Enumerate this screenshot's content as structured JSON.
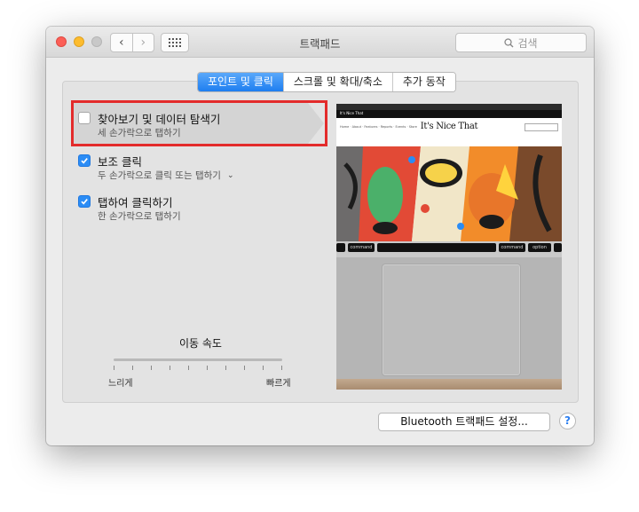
{
  "window": {
    "title": "트랙패드",
    "search_placeholder": "검색",
    "nav_back": "‹",
    "nav_forward": "›"
  },
  "tabs": [
    {
      "label": "포인트 및 클릭",
      "active": true
    },
    {
      "label": "스크롤 및 확대/축소",
      "active": false
    },
    {
      "label": "추가 동작",
      "active": false
    }
  ],
  "options": [
    {
      "title": "찾아보기 및 데이터 탐색기",
      "subtitle": "세 손가락으로 탭하기",
      "checked": false,
      "has_dropdown": false
    },
    {
      "title": "보조 클릭",
      "subtitle": "두 손가락으로 클릭 또는 탭하기",
      "checked": true,
      "has_dropdown": true
    },
    {
      "title": "탭하여 클릭하기",
      "subtitle": "한 손가락으로 탭하기",
      "checked": true,
      "has_dropdown": false
    }
  ],
  "tracking_speed": {
    "label": "이동 속도",
    "min_label": "느리게",
    "max_label": "빠르게",
    "value_fraction": 0.35
  },
  "preview": {
    "site_title": "It's Nice That",
    "site_brand": "It's Nice That",
    "keys": [
      "command",
      "command",
      "option"
    ]
  },
  "footer": {
    "bluetooth_button": "Bluetooth 트랙패드 설정...",
    "help_button": "?"
  },
  "colors": {
    "accent": "#2b8cf5",
    "highlight_border": "#e32b2b"
  }
}
